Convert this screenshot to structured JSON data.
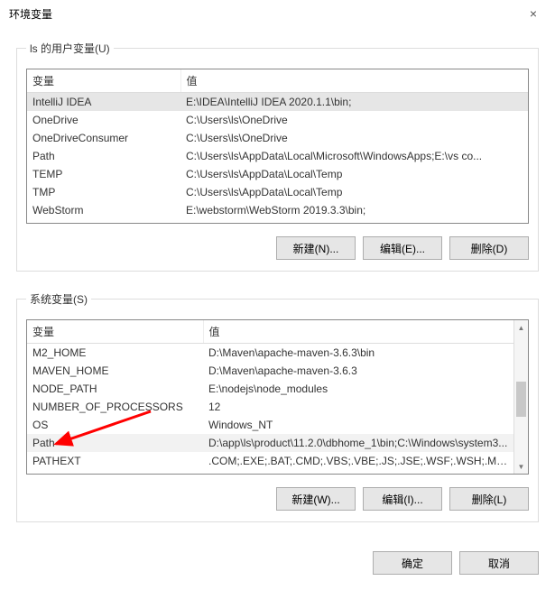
{
  "window": {
    "title": "环境变量",
    "close_icon": "×"
  },
  "userVars": {
    "legend": "ls 的用户变量(U)",
    "headers": {
      "var": "变量",
      "val": "值"
    },
    "rows": [
      {
        "var": "IntelliJ IDEA",
        "val": "E:\\IDEA\\IntelliJ IDEA 2020.1.1\\bin;",
        "selected": true
      },
      {
        "var": "OneDrive",
        "val": "C:\\Users\\ls\\OneDrive"
      },
      {
        "var": "OneDriveConsumer",
        "val": "C:\\Users\\ls\\OneDrive"
      },
      {
        "var": "Path",
        "val": "C:\\Users\\ls\\AppData\\Local\\Microsoft\\WindowsApps;E:\\vs co..."
      },
      {
        "var": "TEMP",
        "val": "C:\\Users\\ls\\AppData\\Local\\Temp"
      },
      {
        "var": "TMP",
        "val": "C:\\Users\\ls\\AppData\\Local\\Temp"
      },
      {
        "var": "WebStorm",
        "val": "E:\\webstorm\\WebStorm 2019.3.3\\bin;"
      }
    ],
    "buttons": {
      "new": "新建(N)...",
      "edit": "编辑(E)...",
      "del": "删除(D)"
    }
  },
  "sysVars": {
    "legend": "系统变量(S)",
    "headers": {
      "var": "变量",
      "val": "值"
    },
    "rows": [
      {
        "var": "M2_HOME",
        "val": "D:\\Maven\\apache-maven-3.6.3\\bin"
      },
      {
        "var": "MAVEN_HOME",
        "val": "D:\\Maven\\apache-maven-3.6.3"
      },
      {
        "var": "NODE_PATH",
        "val": "E:\\nodejs\\node_modules"
      },
      {
        "var": "NUMBER_OF_PROCESSORS",
        "val": "12"
      },
      {
        "var": "OS",
        "val": "Windows_NT"
      },
      {
        "var": "Path",
        "val": "D:\\app\\ls\\product\\11.2.0\\dbhome_1\\bin;C:\\Windows\\system3...",
        "highlight": true
      },
      {
        "var": "PATHEXT",
        "val": ".COM;.EXE;.BAT;.CMD;.VBS;.VBE;.JS;.JSE;.WSF;.WSH;.MSC"
      }
    ],
    "buttons": {
      "new": "新建(W)...",
      "edit": "编辑(I)...",
      "del": "删除(L)"
    }
  },
  "footer": {
    "ok": "确定",
    "cancel": "取消"
  },
  "annotation": {
    "color": "#ff0000"
  }
}
